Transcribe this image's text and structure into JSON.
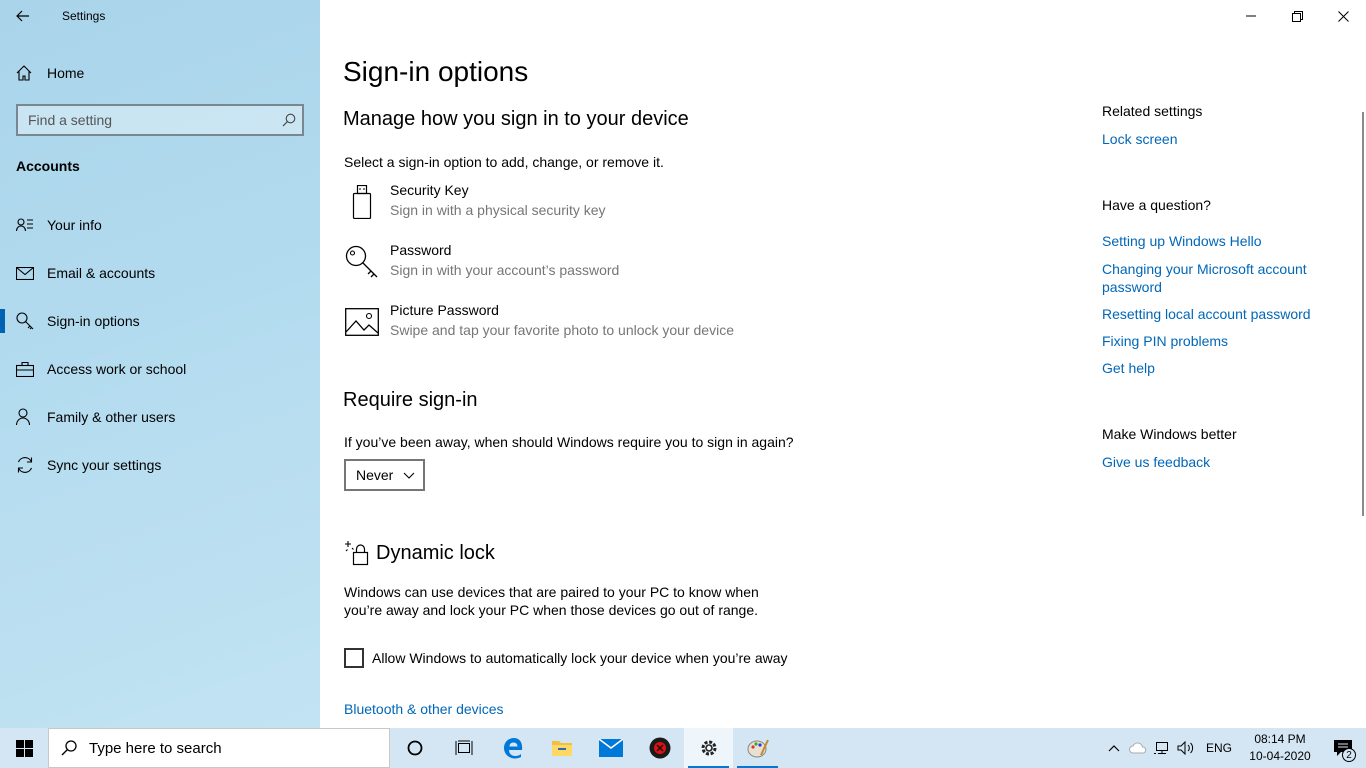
{
  "window": {
    "title": "Settings"
  },
  "sidebar": {
    "home_label": "Home",
    "search_placeholder": "Find a setting",
    "section": "Accounts",
    "items": [
      {
        "label": "Your info",
        "icon": "person-lines-icon"
      },
      {
        "label": "Email & accounts",
        "icon": "mail-icon"
      },
      {
        "label": "Sign-in options",
        "icon": "key-icon",
        "active": true
      },
      {
        "label": "Access work or school",
        "icon": "briefcase-icon"
      },
      {
        "label": "Family & other users",
        "icon": "person-add-icon"
      },
      {
        "label": "Sync your settings",
        "icon": "sync-icon"
      }
    ]
  },
  "main": {
    "title": "Sign-in options",
    "manage_heading": "Manage how you sign in to your device",
    "manage_sub": "Select a sign-in option to add, change, or remove it.",
    "options": [
      {
        "title": "Security Key",
        "sub": "Sign in with a physical security key",
        "icon": "usb-key-icon"
      },
      {
        "title": "Password",
        "sub": "Sign in with your account’s password",
        "icon": "key-icon"
      },
      {
        "title": "Picture Password",
        "sub": "Swipe and tap your favorite photo to unlock your device",
        "icon": "picture-icon"
      }
    ],
    "require_heading": "Require sign-in",
    "require_question": "If you’ve been away, when should Windows require you to sign in again?",
    "require_value": "Never",
    "dynamic_heading": "Dynamic lock",
    "dynamic_desc": "Windows can use devices that are paired to your PC to know when you’re away and lock your PC when those devices go out of range.",
    "dynamic_checkbox": "Allow Windows to automatically lock your device when you’re away",
    "bluetooth_link": "Bluetooth & other devices"
  },
  "right": {
    "related_heading": "Related settings",
    "lock_screen": "Lock screen",
    "question_heading": "Have a question?",
    "links": {
      "hello": "Setting up Windows Hello",
      "ms_password": "Changing your Microsoft account password",
      "local_password": "Resetting local account password",
      "pin": "Fixing PIN problems",
      "help": "Get help"
    },
    "better_heading": "Make Windows better",
    "feedback": "Give us feedback"
  },
  "taskbar": {
    "search_placeholder": "Type here to search",
    "lang": "ENG",
    "time": "08:14 PM",
    "date": "10-04-2020",
    "notifications": "2"
  },
  "colors": {
    "accent": "#0067b8",
    "sidebar_bg": "#b3dbef",
    "taskbar_bg": "#d4e6f4"
  }
}
